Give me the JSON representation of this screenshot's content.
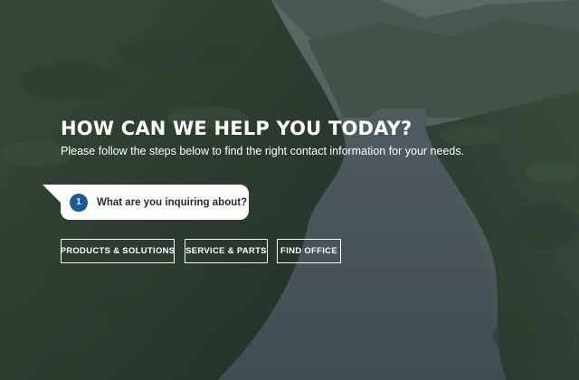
{
  "hero": {
    "headline": "HOW CAN WE HELP YOU TODAY?",
    "subtitle": "Please follow the steps below to find the right contact information for your needs."
  },
  "step": {
    "number": "1",
    "question": "What are you inquiring about?"
  },
  "options": [
    {
      "label": "PRODUCTS & SOLUTIONS"
    },
    {
      "label": "SERVICE & PARTS"
    },
    {
      "label": "FIND OFFICE"
    }
  ],
  "colors": {
    "step_badge": "#1a5b96",
    "bubble": "#ffffff",
    "text_on_hero": "#ffffff",
    "forest_dark": "#2b3a2c",
    "river": "#56636a"
  }
}
